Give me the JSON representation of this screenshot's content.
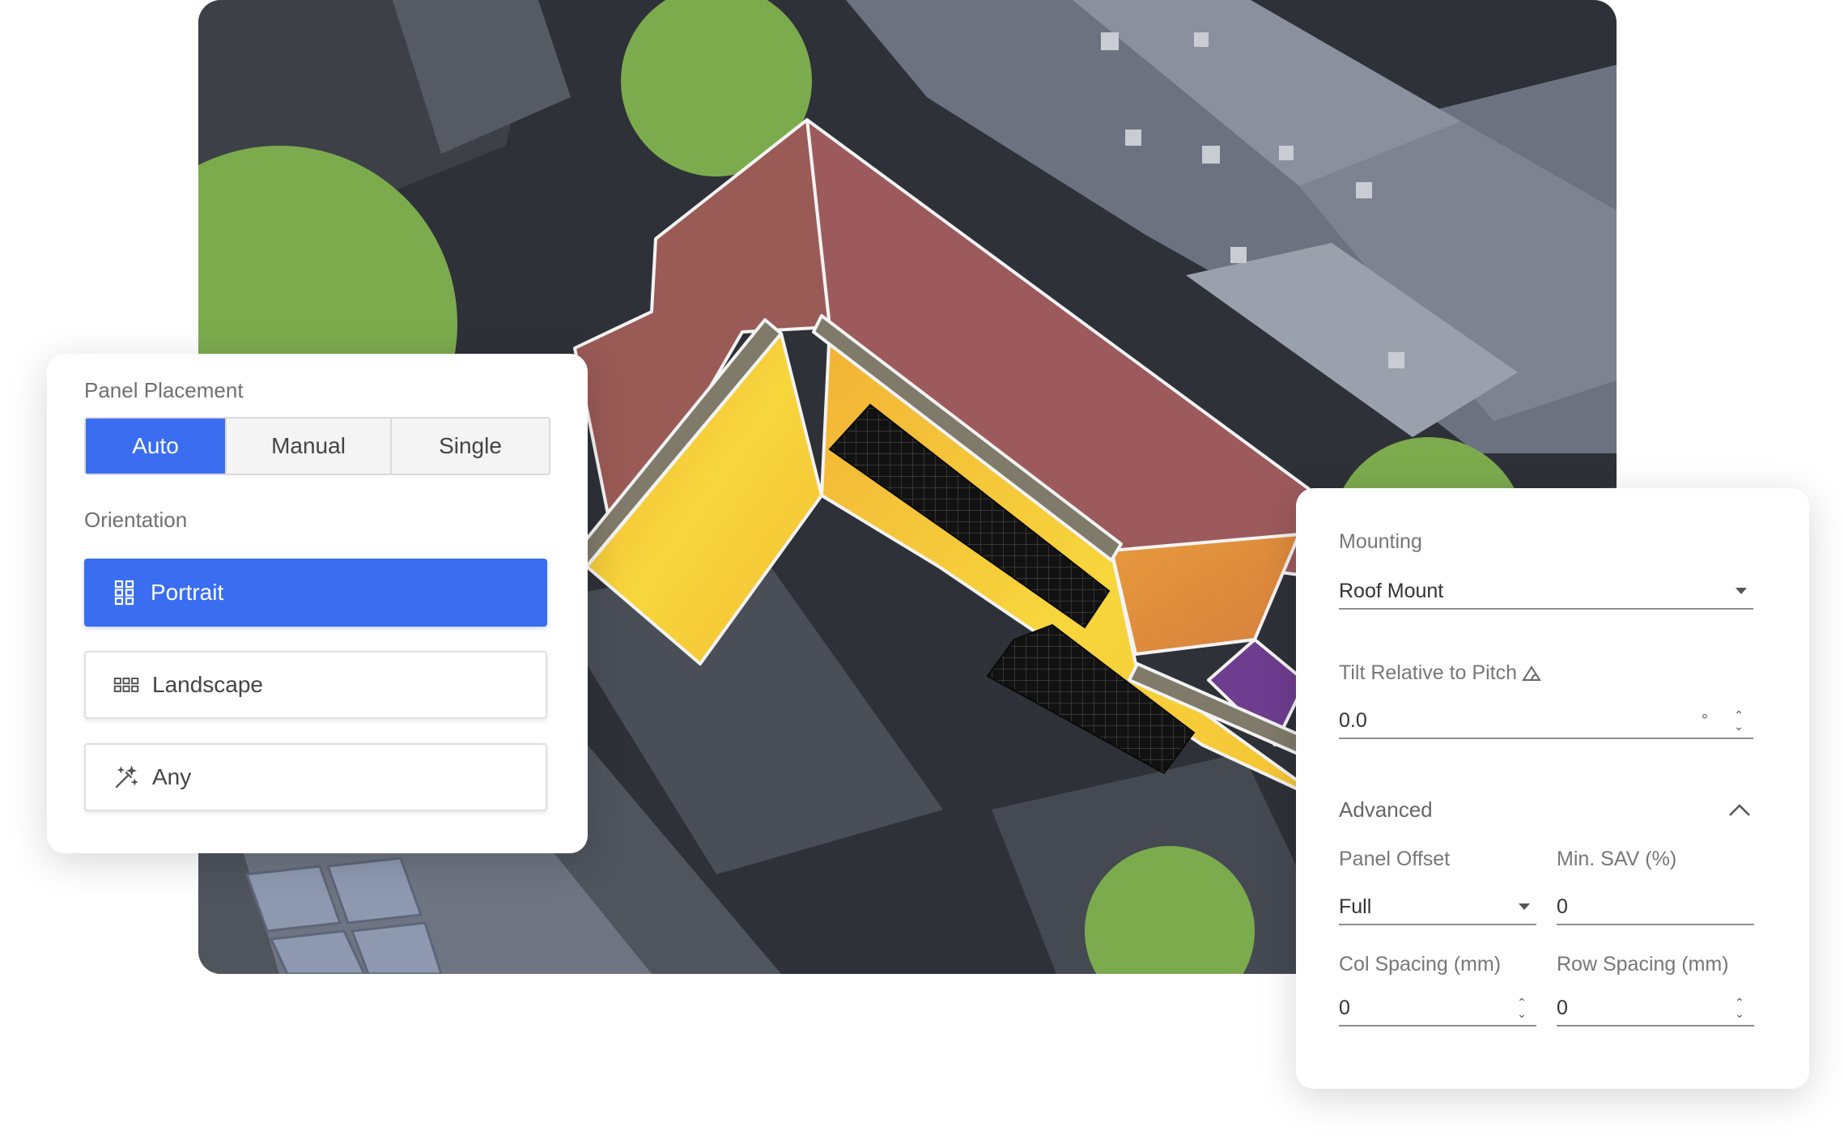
{
  "panel_placement": {
    "label": "Panel Placement",
    "modes": [
      "Auto",
      "Manual",
      "Single"
    ],
    "active_mode": "Auto"
  },
  "orientation": {
    "label": "Orientation",
    "options": [
      {
        "label": "Portrait",
        "icon": "grid-portrait-icon",
        "active": true
      },
      {
        "label": "Landscape",
        "icon": "grid-landscape-icon",
        "active": false
      },
      {
        "label": "Any",
        "icon": "magic-wand-icon",
        "active": false
      }
    ]
  },
  "mounting": {
    "label": "Mounting",
    "value": "Roof Mount"
  },
  "tilt": {
    "label": "Tilt Relative to Pitch",
    "icon": "roof-pitch-icon",
    "value": "0.0",
    "unit": "°"
  },
  "advanced": {
    "label": "Advanced",
    "expanded": true,
    "panel_offset": {
      "label": "Panel Offset",
      "value": "Full"
    },
    "min_sav": {
      "label": "Min. SAV (%)",
      "value": "0"
    },
    "col_spacing": {
      "label": "Col Spacing (mm)",
      "value": "0"
    },
    "row_spacing": {
      "label": "Row Spacing (mm)",
      "value": "0"
    }
  },
  "colors": {
    "accent": "#3a6df0",
    "roof_high": "#f7d23a",
    "roof_mid": "#e2913a",
    "roof_low": "#9c5a5c",
    "roof_lowest": "#6e3d8f",
    "tree": "#7cab4e"
  }
}
